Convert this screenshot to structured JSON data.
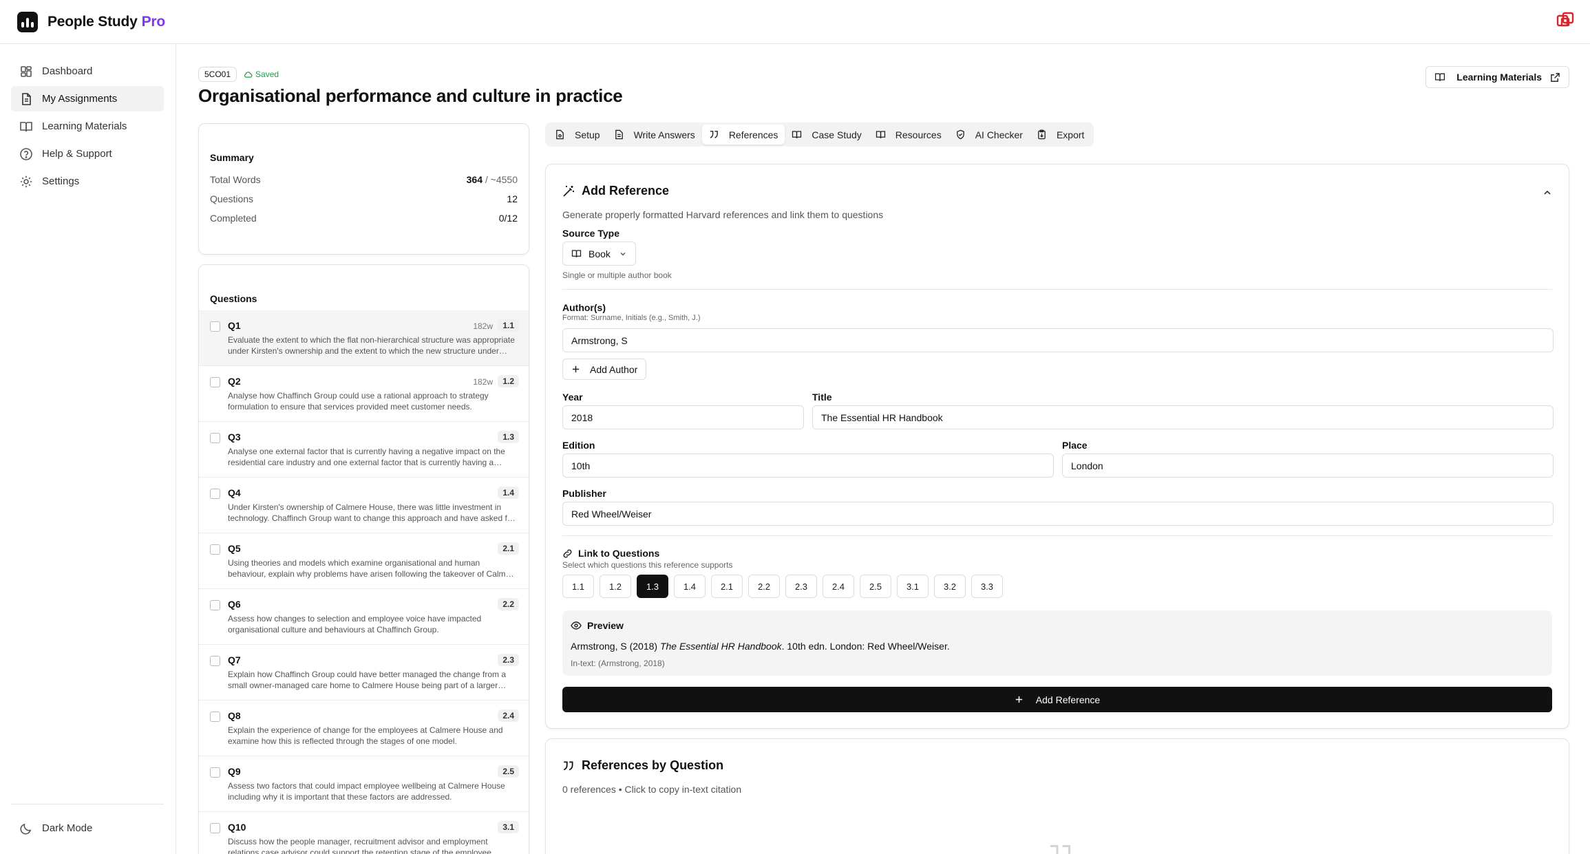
{
  "app": {
    "name": "People Study",
    "name_suffix": "Pro"
  },
  "sidebar": {
    "items": [
      {
        "label": "Dashboard",
        "icon": "dashboard-icon"
      },
      {
        "label": "My Assignments",
        "icon": "document-icon",
        "active": true
      },
      {
        "label": "Learning Materials",
        "icon": "book-icon"
      },
      {
        "label": "Help & Support",
        "icon": "help-icon"
      },
      {
        "label": "Settings",
        "icon": "gear-icon"
      }
    ],
    "dark_mode_label": "Dark Mode"
  },
  "assignment": {
    "code": "5CO01",
    "saved_label": "Saved",
    "title": "Organisational performance and culture in practice",
    "learning_materials_label": "Learning Materials"
  },
  "summary": {
    "title": "Summary",
    "total_words_label": "Total Words",
    "total_words_value": "364",
    "total_words_target": "/ ~4550",
    "questions_label": "Questions",
    "questions_value": "12",
    "completed_label": "Completed",
    "completed_value": "0/12"
  },
  "questions": {
    "title": "Questions",
    "items": [
      {
        "label": "Q1",
        "words": "182w",
        "num": "1.1",
        "text": "Evaluate the extent to which the flat non-hierarchical structure was appropriate under Kirsten's ownership and the extent to which the new structure under Chaffinch Group is appropriate.",
        "active": true
      },
      {
        "label": "Q2",
        "words": "182w",
        "num": "1.2",
        "text": "Analyse how Chaffinch Group could use a rational approach to strategy formulation to ensure that services provided meet customer needs."
      },
      {
        "label": "Q3",
        "words": "",
        "num": "1.3",
        "text": "Analyse one external factor that is currently having a negative impact on the residential care industry and one external factor that is currently having a positive impact."
      },
      {
        "label": "Q4",
        "words": "",
        "num": "1.4",
        "text": "Under Kirsten's ownership of Calmere House, there was little investment in technology. Chaffinch Group want to change this approach and have asked for your advice."
      },
      {
        "label": "Q5",
        "words": "",
        "num": "2.1",
        "text": "Using theories and models which examine organisational and human behaviour, explain why problems have arisen following the takeover of Calmere House."
      },
      {
        "label": "Q6",
        "words": "",
        "num": "2.2",
        "text": "Assess how changes to selection and employee voice have impacted organisational culture and behaviours at Chaffinch Group."
      },
      {
        "label": "Q7",
        "words": "",
        "num": "2.3",
        "text": "Explain how Chaffinch Group could have better managed the change from a small owner-managed care home to Calmere House being part of a larger group."
      },
      {
        "label": "Q8",
        "words": "",
        "num": "2.4",
        "text": "Explain the experience of change for the employees at Calmere House and examine how this is reflected through the stages of one model."
      },
      {
        "label": "Q9",
        "words": "",
        "num": "2.5",
        "text": "Assess two factors that could impact employee wellbeing at Calmere House including why it is important that these factors are addressed."
      },
      {
        "label": "Q10",
        "words": "",
        "num": "3.1",
        "text": "Discuss how the people manager, recruitment advisor and employment relations case advisor could support the retention stage of the employee lifecycle."
      }
    ]
  },
  "tabs": [
    {
      "label": "Setup",
      "icon": "file-cog-icon"
    },
    {
      "label": "Write Answers",
      "icon": "file-text-icon"
    },
    {
      "label": "References",
      "icon": "quote-icon",
      "active": true
    },
    {
      "label": "Case Study",
      "icon": "book-open-icon"
    },
    {
      "label": "Resources",
      "icon": "library-icon"
    },
    {
      "label": "AI Checker",
      "icon": "shield-check-icon"
    },
    {
      "label": "Export",
      "icon": "clipboard-icon"
    }
  ],
  "add_reference": {
    "title": "Add Reference",
    "description": "Generate properly formatted Harvard references and link them to questions",
    "source_type_label": "Source Type",
    "source_type_value": "Book",
    "source_type_hint": "Single or multiple author book",
    "authors_label": "Author(s)",
    "authors_hint": "Format: Surname, Initials (e.g., Smith, J.)",
    "author_value": "Armstrong, S",
    "add_author_label": "Add Author",
    "year_label": "Year",
    "year_value": "2018",
    "title_label": "Title",
    "title_value": "The Essential HR Handbook",
    "edition_label": "Edition",
    "edition_value": "10th",
    "place_label": "Place",
    "place_value": "London",
    "publisher_label": "Publisher",
    "publisher_value": "Red Wheel/Weiser",
    "link_label": "Link to Questions",
    "link_hint": "Select which questions this reference supports",
    "question_chips": [
      "1.1",
      "1.2",
      "1.3",
      "1.4",
      "2.1",
      "2.2",
      "2.3",
      "2.4",
      "2.5",
      "3.1",
      "3.2",
      "3.3"
    ],
    "selected_chip": "1.3",
    "preview_label": "Preview",
    "preview_author": "Armstrong, S (2018)",
    "preview_title": "The Essential HR Handbook",
    "preview_rest": ". 10th edn. London: Red Wheel/Weiser.",
    "preview_intext": "In-text: (Armstrong, 2018)",
    "submit_label": "Add Reference"
  },
  "references_by_question": {
    "title": "References by Question",
    "subtitle": "0 references • Click to copy in-text citation"
  }
}
